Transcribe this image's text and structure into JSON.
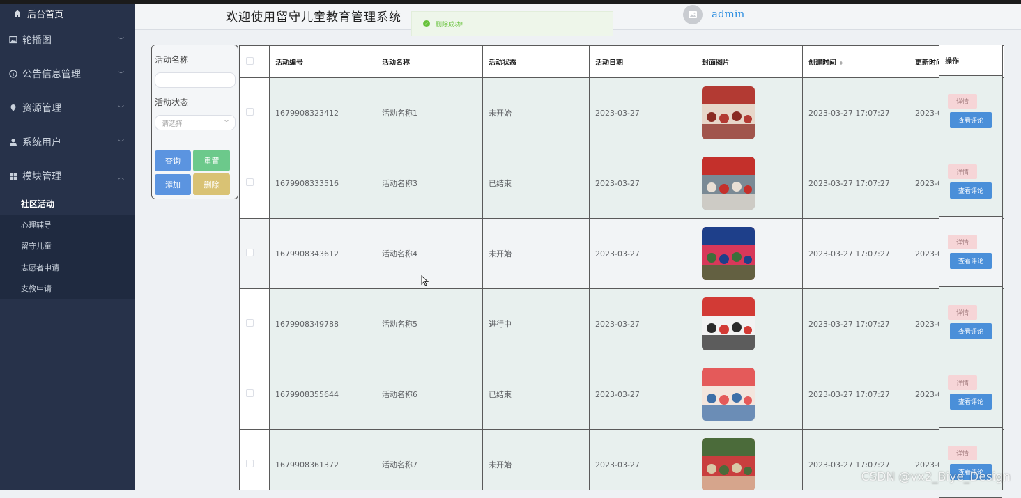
{
  "header": {
    "title": "欢迎使用留守儿童教育管理系统",
    "username": "admin",
    "toast": "删除成功!"
  },
  "sidebar": {
    "home": "后台首页",
    "menus": [
      {
        "label": "轮播图",
        "icon": "image-icon"
      },
      {
        "label": "公告信息管理",
        "icon": "info-icon"
      },
      {
        "label": "资源管理",
        "icon": "location-icon"
      },
      {
        "label": "系统用户",
        "icon": "user-icon"
      },
      {
        "label": "模块管理",
        "icon": "grid-icon"
      }
    ],
    "submenus": [
      "社区活动",
      "心理辅导",
      "留守儿童",
      "志愿者申请",
      "支教申请"
    ],
    "active_submenu": "社区活动"
  },
  "search": {
    "name_label": "活动名称",
    "name_value": "",
    "status_label": "活动状态",
    "status_placeholder": "请选择",
    "query_label": "查询",
    "reset_label": "重置",
    "add_label": "添加",
    "delete_label": "删除"
  },
  "table": {
    "columns": [
      "活动编号",
      "活动名称",
      "活动状态",
      "活动日期",
      "封面图片",
      "创建时间",
      "更新时间",
      "操作"
    ],
    "rows": [
      {
        "id": "1679908323412",
        "name": "活动名称1",
        "status": "未开始",
        "date": "2023-03-27",
        "created": "2023-03-27 17:07:27",
        "updated": "2023-0"
      },
      {
        "id": "1679908333516",
        "name": "活动名称3",
        "status": "已结束",
        "date": "2023-03-27",
        "created": "2023-03-27 17:07:27",
        "updated": "2023-0"
      },
      {
        "id": "1679908343612",
        "name": "活动名称4",
        "status": "未开始",
        "date": "2023-03-27",
        "created": "2023-03-27 17:07:27",
        "updated": "2023-0"
      },
      {
        "id": "1679908349788",
        "name": "活动名称5",
        "status": "进行中",
        "date": "2023-03-27",
        "created": "2023-03-27 17:07:27",
        "updated": "2023-0"
      },
      {
        "id": "1679908355644",
        "name": "活动名称6",
        "status": "已结束",
        "date": "2023-03-27",
        "created": "2023-03-27 17:07:27",
        "updated": "2023-0"
      },
      {
        "id": "1679908361372",
        "name": "活动名称7",
        "status": "未开始",
        "date": "2023-03-27",
        "created": "2023-03-27 17:07:27",
        "updated": "2023-0"
      }
    ],
    "detail_label": "详情",
    "comment_label": "查看评论"
  },
  "watermark": "CSDN @vx2_Biye_Design",
  "colors": {
    "sidebar_bg": "#27324a",
    "primary": "#4a8fd9",
    "success": "#67c23a",
    "warning": "#d9c274",
    "danger_light": "#f6d5d7",
    "username": "#2f8fe0"
  }
}
